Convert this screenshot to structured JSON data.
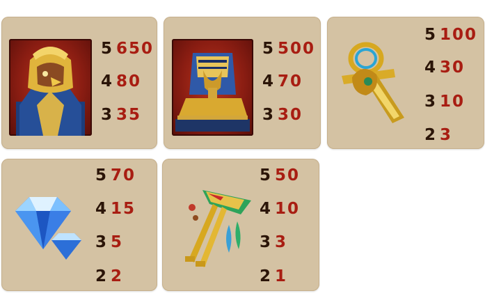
{
  "colors": {
    "card_bg": "#d4c2a3",
    "count_color": "#2b1508",
    "value_color": "#a81d12"
  },
  "symbols": [
    {
      "icon": "horus-icon",
      "pays": [
        {
          "count": "5",
          "value": "650"
        },
        {
          "count": "4",
          "value": "80"
        },
        {
          "count": "3",
          "value": "35"
        }
      ]
    },
    {
      "icon": "sphinx-icon",
      "pays": [
        {
          "count": "5",
          "value": "500"
        },
        {
          "count": "4",
          "value": "70"
        },
        {
          "count": "3",
          "value": "30"
        }
      ]
    },
    {
      "icon": "ankh-icon",
      "pays": [
        {
          "count": "5",
          "value": "100"
        },
        {
          "count": "4",
          "value": "30"
        },
        {
          "count": "3",
          "value": "10"
        },
        {
          "count": "2",
          "value": "3"
        }
      ]
    },
    {
      "icon": "diamond-icon",
      "pays": [
        {
          "count": "5",
          "value": "70"
        },
        {
          "count": "4",
          "value": "15"
        },
        {
          "count": "3",
          "value": "5"
        },
        {
          "count": "2",
          "value": "2"
        }
      ]
    },
    {
      "icon": "key-icon",
      "pays": [
        {
          "count": "5",
          "value": "50"
        },
        {
          "count": "4",
          "value": "10"
        },
        {
          "count": "3",
          "value": "3"
        },
        {
          "count": "2",
          "value": "1"
        }
      ]
    }
  ]
}
